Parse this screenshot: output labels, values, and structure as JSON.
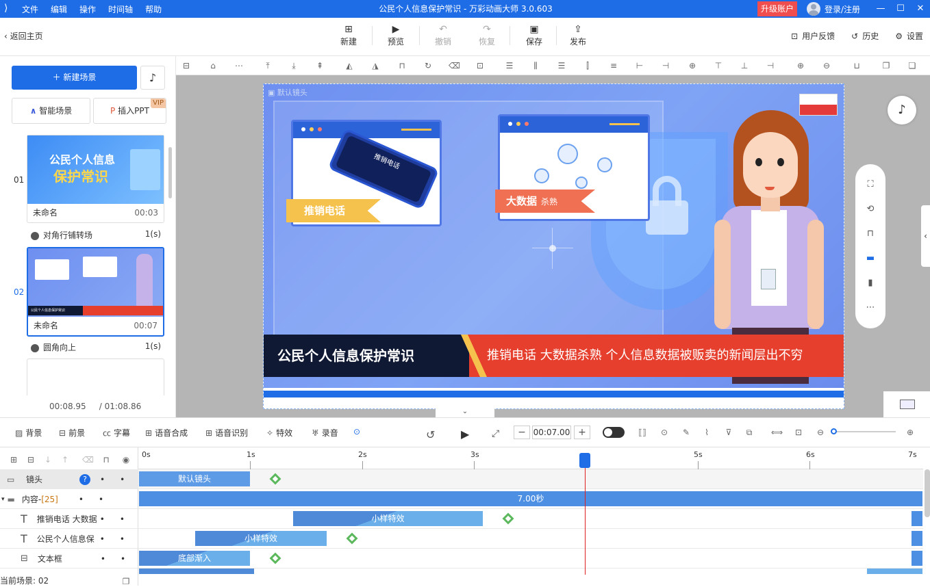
{
  "titlebar": {
    "menu": [
      "文件",
      "编辑",
      "操作",
      "时间轴",
      "帮助"
    ],
    "title": "公民个人信息保护常识 - 万彩动画大师 3.0.603",
    "upgrade": "升级账户",
    "login": "登录/注册",
    "accent": "#1e6de6"
  },
  "toolbar": {
    "back": "返回主页",
    "buttons": [
      "新建",
      "预览",
      "撤销",
      "恢复",
      "保存",
      "发布"
    ],
    "right": [
      "用户反馈",
      "历史",
      "设置"
    ]
  },
  "left": {
    "new_scene": "新建场景",
    "smart_scene": "智能场景",
    "insert_ppt": "插入PPT",
    "vip": "VIP",
    "scenes": [
      {
        "num": "01",
        "thumb_title_1": "公民个人信息",
        "thumb_title_2": "保护常识",
        "name": "未命名",
        "duration": "00:03",
        "transition": "对角行铺转场",
        "trans_time": "1(s)"
      },
      {
        "num": "02",
        "thumb_title": "公民个人信息保护常识",
        "name": "未命名",
        "duration": "00:07",
        "transition": "圆角向上",
        "trans_time": "1(s)"
      }
    ],
    "current_time": "00:08.95",
    "total_time": "/ 01:08.86"
  },
  "stage": {
    "camera_label": "默认镜头",
    "phone_text": "推销电话",
    "ribbon1": "推销电话",
    "ribbon2_main": "大数据",
    "ribbon2_small": "杀熟",
    "bottom_title": "公民个人信息保护常识",
    "bottom_sub": "推销电话 大数据杀熟 个人信息数据被贩卖的新闻层出不穷"
  },
  "timeline_toolbar": {
    "left": [
      "背景",
      "前景",
      "字幕",
      "语音合成",
      "语音识别",
      "特效",
      "录音"
    ],
    "time": "00:07.00",
    "minus": "−",
    "plus": "+"
  },
  "timeline": {
    "ticks": [
      "0s",
      "1s",
      "2s",
      "3s",
      "5s",
      "6s",
      "7s"
    ],
    "rows": [
      {
        "label": "镜头",
        "clip": "默认镜头"
      },
      {
        "label": "内容-",
        "count": "[25]",
        "clip": "7.00秒"
      },
      {
        "label": "推销电话 大数据",
        "clip": "小样特效"
      },
      {
        "label": "公民个人信息保",
        "clip": "小样特效"
      },
      {
        "label": "文本框",
        "clip": "底部渐入"
      }
    ],
    "status": "当前场景: 02"
  }
}
